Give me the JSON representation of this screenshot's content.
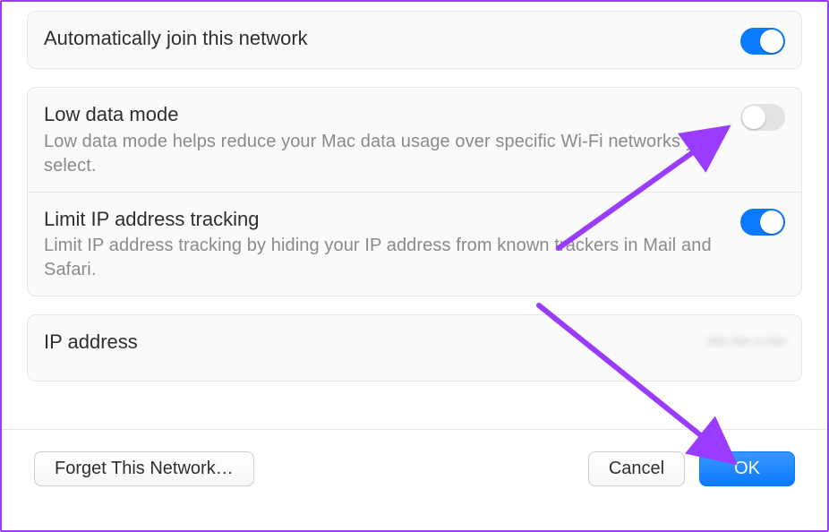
{
  "settings": {
    "auto_join": {
      "title": "Automatically join this network",
      "on": true
    },
    "low_data": {
      "title": "Low data mode",
      "desc": "Low data mode helps reduce your Mac data usage over specific Wi-Fi networks you select.",
      "on": false
    },
    "limit_ip": {
      "title": "Limit IP address tracking",
      "desc": "Limit IP address tracking by hiding your IP address from known trackers in Mail and Safari.",
      "on": true
    },
    "ip_address": {
      "title": "IP address",
      "value_masked": "•••.•••.•.•••"
    }
  },
  "footer": {
    "forget_label": "Forget This Network…",
    "cancel_label": "Cancel",
    "ok_label": "OK"
  },
  "annotation": {
    "arrow_color": "#9a3cff",
    "targets": [
      "low-data-mode-toggle",
      "ok-button"
    ]
  }
}
